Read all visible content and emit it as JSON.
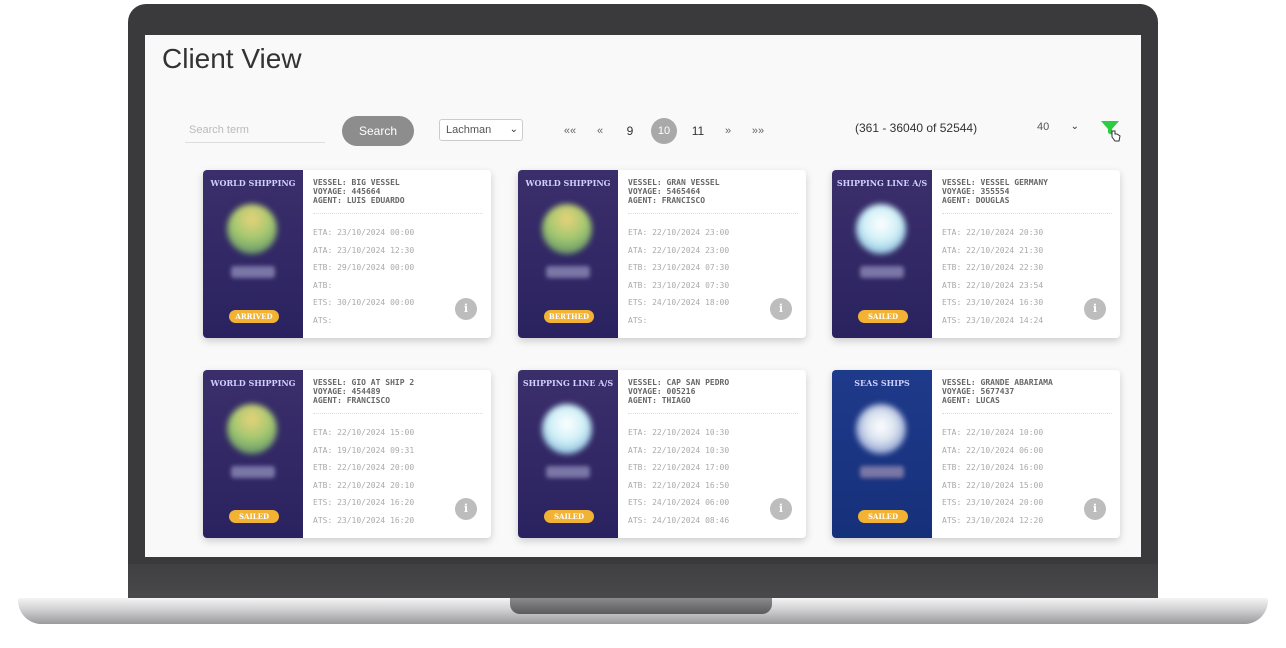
{
  "page": {
    "title": "Client View"
  },
  "toolbar": {
    "search_placeholder": "Search term",
    "search_label": "Search",
    "agent_selected": "Lachman",
    "pager": {
      "first": "««",
      "prev": "«",
      "pages": [
        "9",
        "10",
        "11"
      ],
      "active": "10",
      "next": "»",
      "last": "»»"
    },
    "range_text": "(361 - 36040 of 52544)",
    "page_size": "40"
  },
  "colors": {
    "accent_green": "#2ecc40",
    "badge": "#f2b234",
    "card_purple": "#2f2565",
    "card_blue": "#1a3480"
  },
  "cards": [
    {
      "line": "WORLD SHIPPING",
      "vessel": "VESSEL: BIG VESSEL",
      "voyage": "VOYAGE: 445664",
      "agent": "AGENT: LUIS EDUARDO",
      "eta": "ETA: 23/10/2024 00:00",
      "ata": "ATA: 23/10/2024 12:30",
      "etb": "ETB: 29/10/2024 00:00",
      "atb": "ATB:",
      "ets": "ETS: 30/10/2024 00:00",
      "ats": "ATS:",
      "status": "ARRIVED"
    },
    {
      "line": "WORLD SHIPPING",
      "vessel": "VESSEL: GRAN VESSEL",
      "voyage": "VOYAGE: 5465464",
      "agent": "AGENT: FRANCISCO",
      "eta": "ETA: 22/10/2024 23:00",
      "ata": "ATA: 22/10/2024 23:00",
      "etb": "ETB: 23/10/2024 07:30",
      "atb": "ATB: 23/10/2024 07:30",
      "ets": "ETS: 24/10/2024 18:00",
      "ats": "ATS:",
      "status": "BERTHED"
    },
    {
      "line": "SHIPPING LINE A/S",
      "vessel": "VESSEL: VESSEL GERMANY",
      "voyage": "VOYAGE: 355554",
      "agent": "AGENT: DOUGLAS",
      "eta": "ETA: 22/10/2024 20:30",
      "ata": "ATA: 22/10/2024 21:30",
      "etb": "ETB: 22/10/2024 22:30",
      "atb": "ATB: 22/10/2024 23:54",
      "ets": "ETS: 23/10/2024 16:30",
      "ats": "ATS: 23/10/2024 14:24",
      "status": "SAILED"
    },
    {
      "line": "WORLD SHIPPING",
      "vessel": "VESSEL: GIO AT SHIP 2",
      "voyage": "VOYAGE: 454489",
      "agent": "AGENT: FRANCISCO",
      "eta": "ETA: 22/10/2024 15:00",
      "ata": "ATA: 19/10/2024 09:31",
      "etb": "ETB: 22/10/2024 20:00",
      "atb": "ATB: 22/10/2024 20:10",
      "ets": "ETS: 23/10/2024 16:20",
      "ats": "ATS: 23/10/2024 16:20",
      "status": "SAILED"
    },
    {
      "line": "SHIPPING LINE A/S",
      "vessel": "VESSEL: CAP SAN PEDRO",
      "voyage": "VOYAGE: 005216",
      "agent": "AGENT: THIAGO",
      "eta": "ETA: 22/10/2024 10:30",
      "ata": "ATA: 22/10/2024 10:30",
      "etb": "ETB: 22/10/2024 17:00",
      "atb": "ATB: 22/10/2024 16:50",
      "ets": "ETS: 24/10/2024 06:00",
      "ats": "ATS: 24/10/2024 08:46",
      "status": "SAILED"
    },
    {
      "line": "SEAS SHIPS",
      "vessel": "VESSEL: GRANDE ABARIAMA",
      "voyage": "VOYAGE: 5677437",
      "agent": "AGENT: LUCAS",
      "eta": "ETA: 22/10/2024 10:00",
      "ata": "ATA: 22/10/2024 06:00",
      "etb": "ETB: 22/10/2024 16:00",
      "atb": "ATB: 22/10/2024 15:00",
      "ets": "ETS: 23/10/2024 20:00",
      "ats": "ATS: 23/10/2024 12:20",
      "status": "SAILED"
    }
  ]
}
